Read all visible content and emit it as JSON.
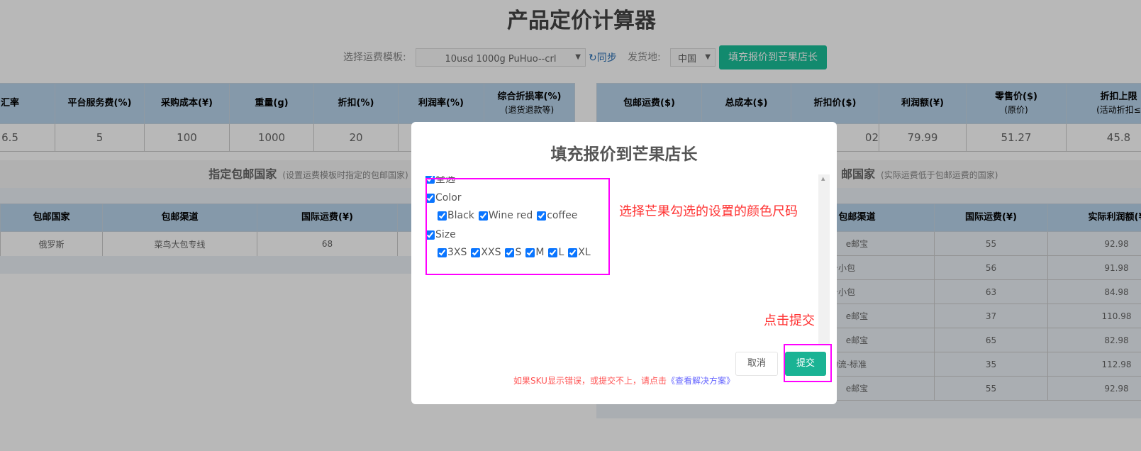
{
  "page": {
    "title": "产品定价计算器"
  },
  "toolbar": {
    "template_label": "选择运费模板:",
    "template_value": "10usd 1000g PuHuo--crl",
    "sync_label": "同步",
    "origin_label": "发货地:",
    "origin_value": "中国",
    "fill_button": "填充报价到芒果店长"
  },
  "left_table": {
    "headers": [
      [
        "汇率",
        ""
      ],
      [
        "平台服务费(%)",
        ""
      ],
      [
        "采购成本(¥)",
        ""
      ],
      [
        "重量(g)",
        ""
      ],
      [
        "折扣(%)",
        ""
      ],
      [
        "利润率(%)",
        ""
      ],
      [
        "综合折损率(%)",
        "(退货退款等)"
      ]
    ],
    "values": [
      "6.5",
      "5",
      "100",
      "1000",
      "20",
      "",
      ""
    ]
  },
  "right_table": {
    "headers": [
      [
        "包邮运费($)",
        ""
      ],
      [
        "总成本($)",
        ""
      ],
      [
        "折扣价($)",
        ""
      ],
      [
        "利润额(¥)",
        ""
      ],
      [
        "零售价($)",
        "(原价)"
      ],
      [
        "折扣上限",
        "(活动折扣≤"
      ]
    ],
    "values": [
      "",
      "",
      "02",
      "79.99",
      "51.27",
      "45.8"
    ]
  },
  "section_left": {
    "title": "指定包邮国家",
    "note": "(设置运费模板时指定的包邮国家)",
    "headers": [
      "包邮国家",
      "包邮渠道",
      "国际运费(¥)"
    ],
    "rows": [
      [
        "俄罗斯",
        "菜鸟大包专线",
        "68"
      ]
    ]
  },
  "section_right": {
    "title": "邮国家",
    "note": "(实际运费低于包邮运费的国家)",
    "headers": [
      "包邮渠道",
      "国际运费(¥)",
      "实际利润额(¥"
    ],
    "rows": [
      [
        "e邮宝",
        "55",
        "92.98"
      ],
      [
        "国邮政挂号小包",
        "56",
        "91.98"
      ],
      [
        "国邮政挂号小包",
        "63",
        "84.98"
      ],
      [
        "e邮宝",
        "37",
        "110.98"
      ],
      [
        "e邮宝",
        "65",
        "82.98"
      ],
      [
        "ess 无忧物流-标准",
        "35",
        "112.98"
      ],
      [
        "e邮宝",
        "55",
        "92.98"
      ]
    ]
  },
  "modal": {
    "title": "填充报价到芒果店长",
    "select_all": "全选",
    "groups": [
      {
        "name": "Color",
        "options": [
          "Black",
          "Wine red",
          "coffee"
        ]
      },
      {
        "name": "Size",
        "options": [
          "3XS",
          "XXS",
          "S",
          "M",
          "L",
          "XL"
        ]
      }
    ],
    "cancel": "取消",
    "submit": "提交",
    "footer_text": "如果SKU显示错误，或提交不上，请点击",
    "footer_link": "《查看解决方案》"
  },
  "annotations": {
    "select_hint": "选择芒果勾选的设置的颜色尺码",
    "submit_hint": "点击提交",
    "color": "#ff00ff"
  }
}
